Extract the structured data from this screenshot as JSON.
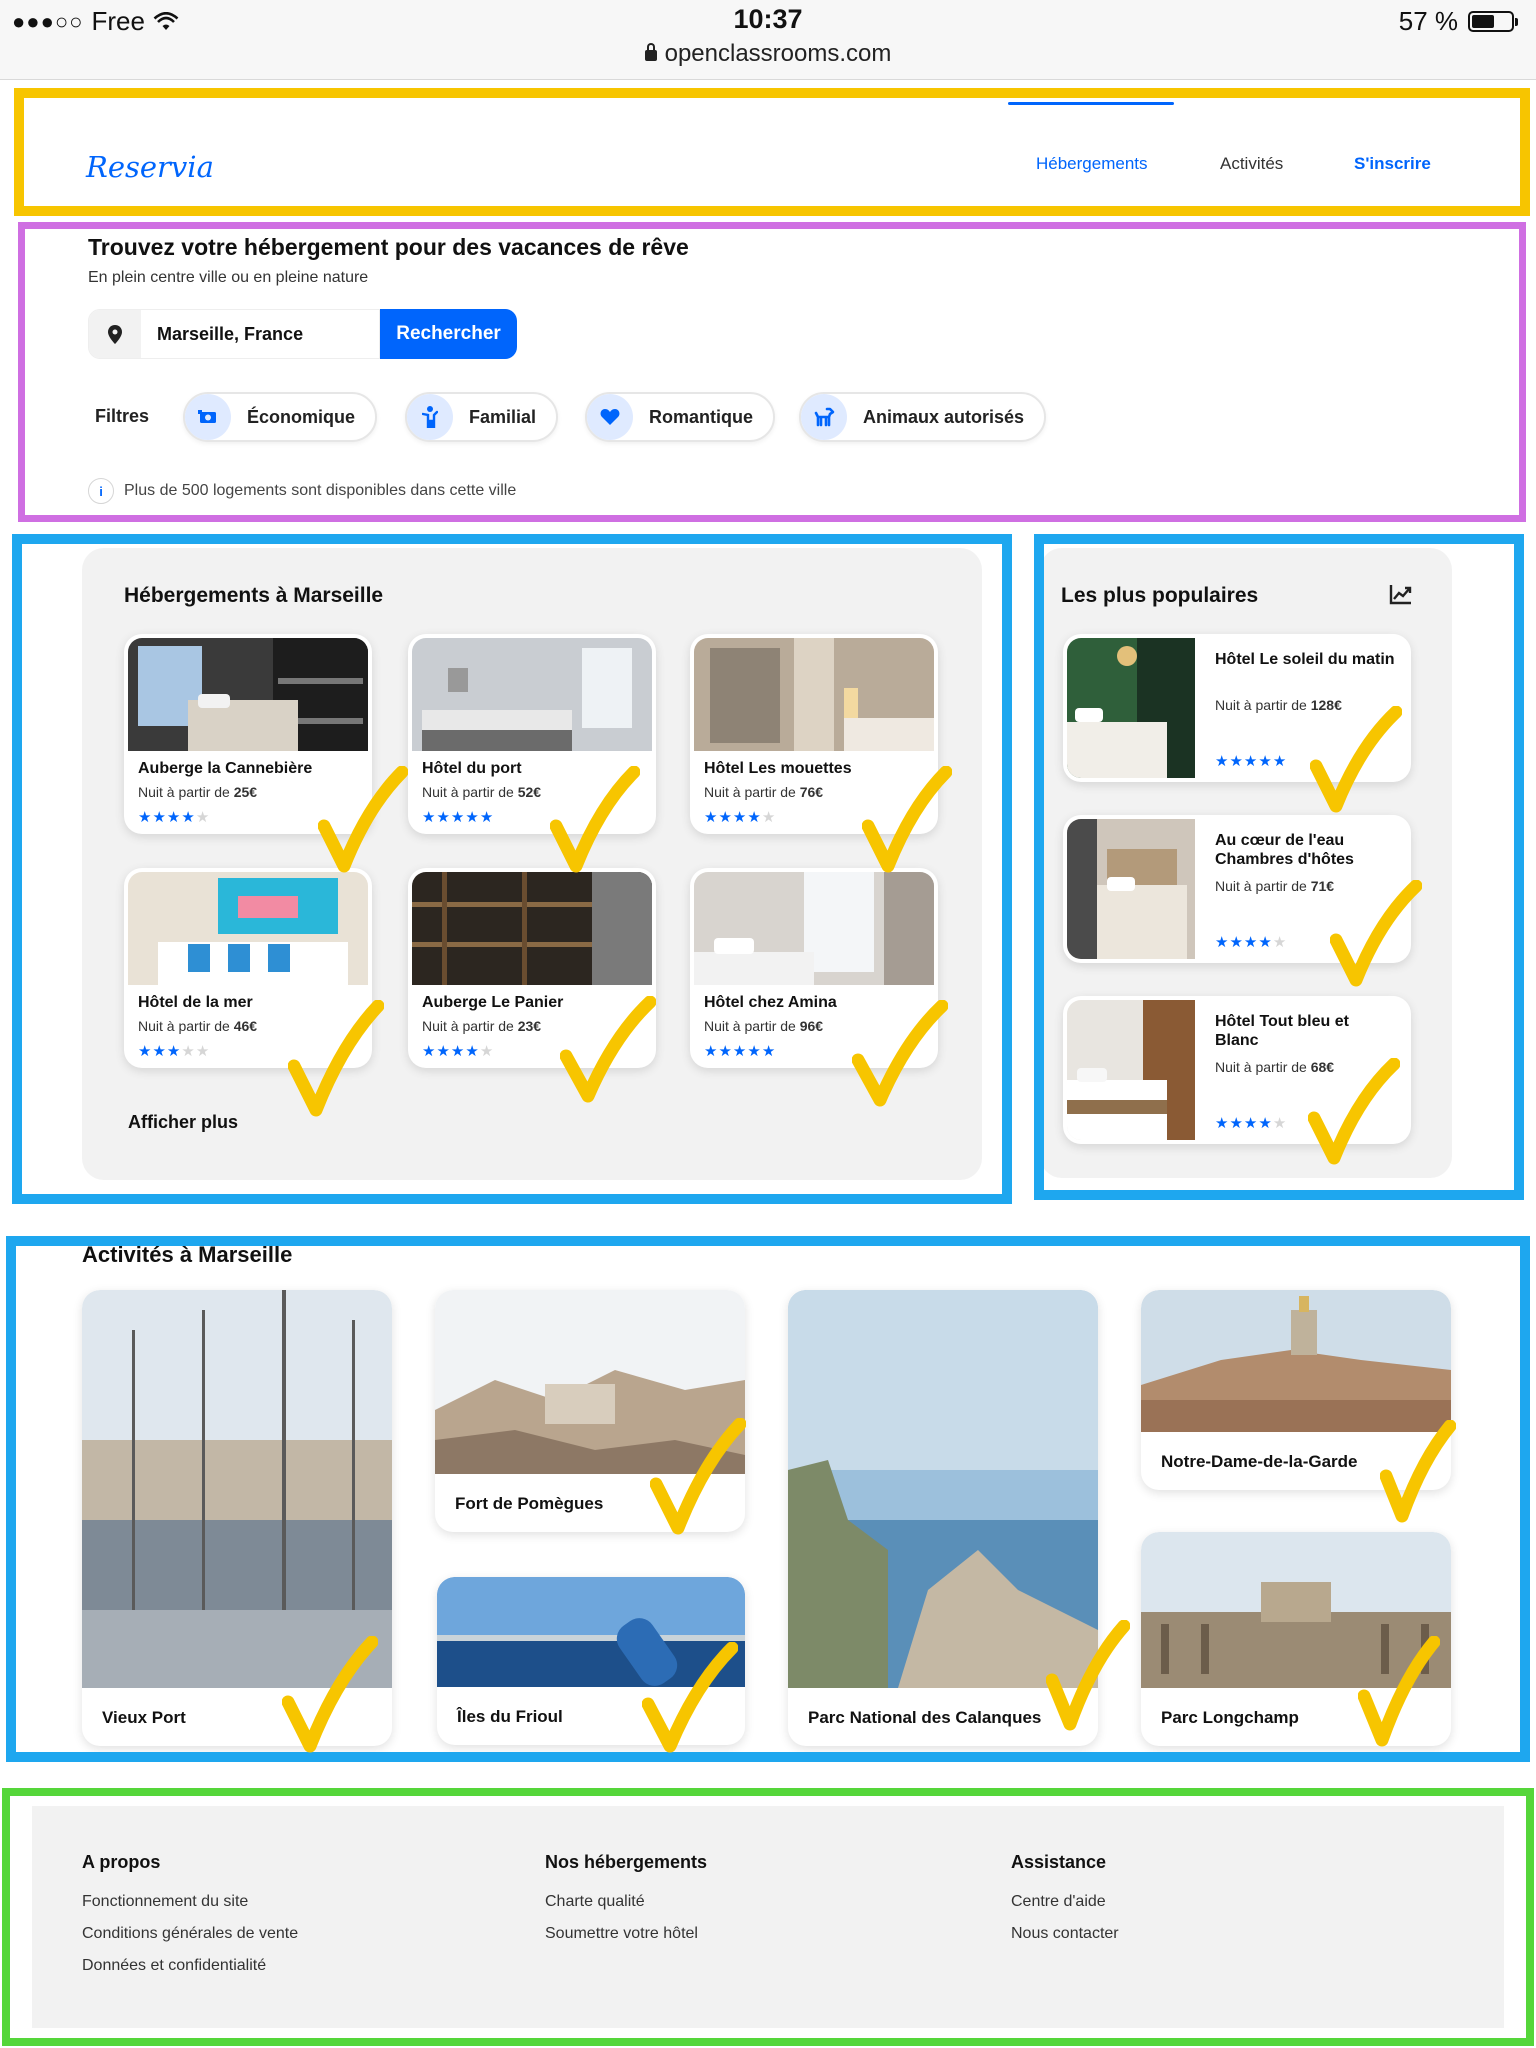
{
  "status_bar": {
    "carrier": "Free",
    "time": "10:37",
    "battery_percent": "57 %",
    "battery_level": 0.57,
    "url": "openclassrooms.com"
  },
  "header": {
    "logo": "Reservia",
    "nav": [
      {
        "label": "Hébergements",
        "active": true
      },
      {
        "label": "Activités",
        "active": false
      },
      {
        "label": "S'inscrire",
        "active": false
      }
    ]
  },
  "hero": {
    "title": "Trouvez votre hébergement pour des vacances de rêve",
    "subtitle": "En plein centre ville ou en pleine nature",
    "search_value": "Marseille, France",
    "search_button": "Rechercher",
    "filters_label": "Filtres",
    "filters": [
      {
        "label": "Économique",
        "icon": "money-icon"
      },
      {
        "label": "Familial",
        "icon": "child-icon"
      },
      {
        "label": "Romantique",
        "icon": "heart-icon"
      },
      {
        "label": "Animaux autorisés",
        "icon": "dog-icon"
      }
    ],
    "info": "Plus de 500 logements sont disponibles dans cette ville"
  },
  "accommodations": {
    "title": "Hébergements à Marseille",
    "price_prefix": "Nuit à partir de",
    "items": [
      {
        "name": "Auberge la Cannebière",
        "price_prefix": "Nuit à partir de",
        "price": "25€",
        "rating": 4
      },
      {
        "name": "Hôtel du port",
        "price_prefix": "Nuit à partir de",
        "price": "52€",
        "rating": 5
      },
      {
        "name": "Hôtel Les mouettes",
        "price_prefix": "Nuit à partir de",
        "price": "76€",
        "rating": 4
      },
      {
        "name": "Hôtel de la mer",
        "price_prefix": "Nuit à partir de",
        "price": "46€",
        "rating": 3
      },
      {
        "name": "Auberge Le Panier",
        "price_prefix": "Nuit à partir de",
        "price": "23€",
        "rating": 4
      },
      {
        "name": "Hôtel chez Amina",
        "price_prefix": "Nuit à partir de",
        "price": "96€",
        "rating": 5
      }
    ],
    "more": "Afficher plus"
  },
  "popular": {
    "title": "Les plus populaires",
    "items": [
      {
        "name": "Hôtel Le soleil du matin",
        "price_prefix": "Nuit à partir de",
        "price": "128€",
        "rating": 5
      },
      {
        "name": "Au cœur de l'eau Chambres d'hôtes",
        "price_prefix": "Nuit à partir de",
        "price": "71€",
        "rating": 4
      },
      {
        "name": "Hôtel Tout bleu et Blanc",
        "price_prefix": "Nuit à partir de",
        "price": "68€",
        "rating": 4
      }
    ]
  },
  "activities": {
    "title": "Activités à Marseille",
    "items": [
      {
        "name": "Vieux Port"
      },
      {
        "name": "Fort de Pomègues"
      },
      {
        "name": "Îles du Frioul"
      },
      {
        "name": "Parc National des Calanques"
      },
      {
        "name": "Notre-Dame-de-la-Garde"
      },
      {
        "name": "Parc Longchamp"
      }
    ]
  },
  "footer": {
    "columns": [
      {
        "title": "A propos",
        "links": [
          "Fonctionnement du site",
          "Conditions générales de vente",
          "Données et confidentialité"
        ]
      },
      {
        "title": "Nos hébergements",
        "links": [
          "Charte qualité",
          "Soumettre votre hôtel"
        ]
      },
      {
        "title": "Assistance",
        "links": [
          "Centre d'aide",
          "Nous contacter"
        ]
      }
    ]
  },
  "colors": {
    "brand": "#0065fc",
    "annotation_yellow": "#f7c500",
    "annotation_purple": "#cf6fe2",
    "annotation_blue": "#1ea7ef",
    "annotation_green": "#55d63a",
    "star_off": "#d6d6d6"
  }
}
